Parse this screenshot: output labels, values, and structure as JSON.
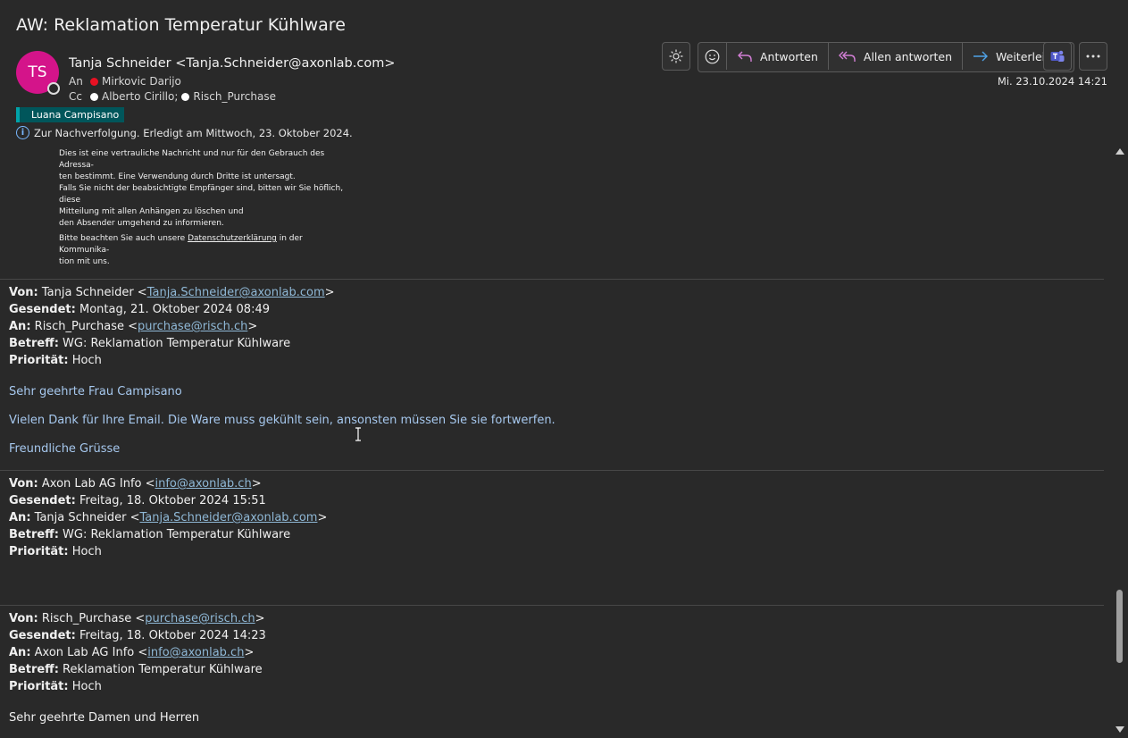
{
  "subject": "AW: Reklamation Temperatur Kühlware",
  "sender": {
    "initials": "TS",
    "display": "Tanja Schneider <Tanja.Schneider@axonlab.com>",
    "avatar_color": "#d4148a"
  },
  "recipients": {
    "to_label": "An",
    "to": "Mirkovic Darijo",
    "cc_label": "Cc",
    "cc": [
      "Alberto Cirillo;",
      "Risch_Purchase"
    ]
  },
  "category_tag": "Luana Campisano",
  "follow_up": "Zur Nachverfolgung.  Erledigt am Mittwoch, 23. Oktober 2024.",
  "disclaimer": {
    "lines": [
      "Dies ist eine vertrauliche Nachricht und nur für den Gebrauch des Adressa-",
      "ten bestimmt. Eine Verwendung durch Dritte ist untersagt.",
      "Falls Sie nicht der beabsichtigte Empfänger sind, bitten wir Sie höflich, diese",
      "Mitteilung mit allen Anhängen zu löschen und",
      "den Absender umgehend zu informieren."
    ],
    "privacy_prefix": "Bitte beachten Sie auch unsere ",
    "privacy_link": "Datenschutzerklärung",
    "privacy_suffix": " in der Kommunika-",
    "privacy_line2": "tion mit uns."
  },
  "toolbar": {
    "brightness_icon": "sun-icon",
    "emoji_icon": "smiley-icon",
    "reply": "Antworten",
    "reply_all": "Allen antworten",
    "forward": "Weiterleiten",
    "teams_icon": "teams-icon",
    "more_icon": "more-icon"
  },
  "datetime": "Mi. 23.10.2024 14:21",
  "labels": {
    "from": "Von:",
    "sent": "Gesendet:",
    "to": "An:",
    "subject": "Betreff:",
    "priority": "Priorität:"
  },
  "thread": [
    {
      "from_name": "Tanja Schneider <",
      "from_email": "Tanja.Schneider@axonlab.com",
      "sent": "Montag, 21. Oktober 2024 08:49",
      "to_name": "Risch_Purchase <",
      "to_email": "purchase@risch.ch",
      "subject": "WG: Reklamation Temperatur Kühlware",
      "priority": "Hoch",
      "body": [
        "Sehr geehrte Frau Campisano",
        "Vielen Dank für Ihre Email. Die Ware muss gekühlt sein, ansonsten müssen Sie sie fortwerfen.",
        "Freundliche Grüsse"
      ]
    },
    {
      "from_name": "Axon Lab AG Info <",
      "from_email": "info@axonlab.ch",
      "sent": "Freitag, 18. Oktober 2024 15:51",
      "to_name": "Tanja Schneider <",
      "to_email": "Tanja.Schneider@axonlab.com",
      "subject": "WG: Reklamation Temperatur Kühlware",
      "priority": "Hoch"
    },
    {
      "from_name": "Risch_Purchase <",
      "from_email": "purchase@risch.ch",
      "sent": "Freitag, 18. Oktober 2024 14:23",
      "to_name": "Axon Lab AG Info <",
      "to_email": "info@axonlab.ch",
      "subject": "Reklamation Temperatur Kühlware",
      "priority": "Hoch",
      "body": [
        "Sehr geehrte Damen und Herren"
      ]
    }
  ]
}
